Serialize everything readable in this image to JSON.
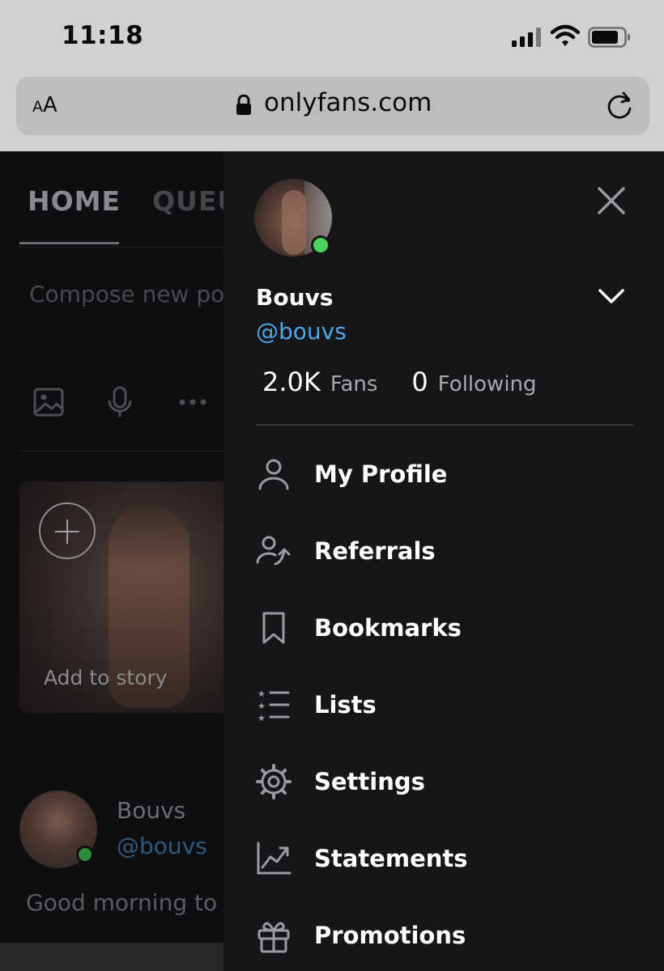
{
  "status_bar": {
    "time": "11:18"
  },
  "browser": {
    "text_size_label": "AA",
    "url": "onlyfans.com"
  },
  "background": {
    "tabs": [
      "HOME",
      "QUEU"
    ],
    "compose_placeholder": "Compose new po",
    "story_label": "Add to story",
    "post": {
      "name": "Bouvs",
      "handle": "@bouvs",
      "text": "Good morning to"
    }
  },
  "drawer": {
    "name": "Bouvs",
    "handle": "@bouvs",
    "stats": {
      "fans_count": "2.0K",
      "fans_label": "Fans",
      "following_count": "0",
      "following_label": "Following"
    },
    "menu": [
      {
        "label": "My Profile",
        "icon": "person-icon"
      },
      {
        "label": "Referrals",
        "icon": "referrals-icon"
      },
      {
        "label": "Bookmarks",
        "icon": "bookmark-icon"
      },
      {
        "label": "Lists",
        "icon": "list-icon"
      },
      {
        "label": "Settings",
        "icon": "gear-icon"
      },
      {
        "label": "Statements",
        "icon": "chart-icon"
      },
      {
        "label": "Promotions",
        "icon": "gift-icon"
      }
    ]
  },
  "colors": {
    "accent": "#4aa6e8",
    "online": "#4cd25a",
    "drawer_bg": "#161618"
  }
}
